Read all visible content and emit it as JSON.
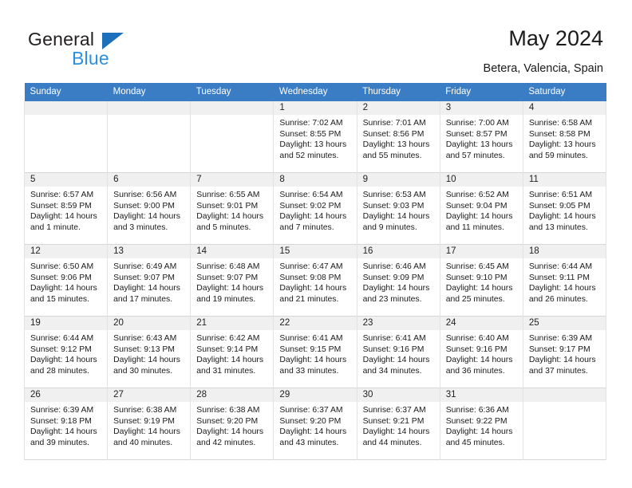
{
  "brand": {
    "name_top": "General",
    "name_bottom": "Blue",
    "triangle_color": "#1c6fba",
    "blue_color": "#2b8fe0"
  },
  "header": {
    "title": "May 2024",
    "location": "Betera, Valencia, Spain"
  },
  "theme": {
    "header_row_bg": "#3b7dc4",
    "header_row_text": "#ffffff",
    "daynum_bg": "#f0f0f0",
    "grid_line": "#e3e3e3"
  },
  "weekdays": [
    "Sunday",
    "Monday",
    "Tuesday",
    "Wednesday",
    "Thursday",
    "Friday",
    "Saturday"
  ],
  "labels": {
    "sunrise_prefix": "Sunrise: ",
    "sunset_prefix": "Sunset: ",
    "daylight_prefix": "Daylight: "
  },
  "weeks": [
    [
      {
        "empty": true
      },
      {
        "empty": true
      },
      {
        "empty": true
      },
      {
        "day": "1",
        "sunrise": "Sunrise: 7:02 AM",
        "sunset": "Sunset: 8:55 PM",
        "daylight_l1": "Daylight: 13 hours",
        "daylight_l2": "and 52 minutes."
      },
      {
        "day": "2",
        "sunrise": "Sunrise: 7:01 AM",
        "sunset": "Sunset: 8:56 PM",
        "daylight_l1": "Daylight: 13 hours",
        "daylight_l2": "and 55 minutes."
      },
      {
        "day": "3",
        "sunrise": "Sunrise: 7:00 AM",
        "sunset": "Sunset: 8:57 PM",
        "daylight_l1": "Daylight: 13 hours",
        "daylight_l2": "and 57 minutes."
      },
      {
        "day": "4",
        "sunrise": "Sunrise: 6:58 AM",
        "sunset": "Sunset: 8:58 PM",
        "daylight_l1": "Daylight: 13 hours",
        "daylight_l2": "and 59 minutes."
      }
    ],
    [
      {
        "day": "5",
        "sunrise": "Sunrise: 6:57 AM",
        "sunset": "Sunset: 8:59 PM",
        "daylight_l1": "Daylight: 14 hours",
        "daylight_l2": "and 1 minute."
      },
      {
        "day": "6",
        "sunrise": "Sunrise: 6:56 AM",
        "sunset": "Sunset: 9:00 PM",
        "daylight_l1": "Daylight: 14 hours",
        "daylight_l2": "and 3 minutes."
      },
      {
        "day": "7",
        "sunrise": "Sunrise: 6:55 AM",
        "sunset": "Sunset: 9:01 PM",
        "daylight_l1": "Daylight: 14 hours",
        "daylight_l2": "and 5 minutes."
      },
      {
        "day": "8",
        "sunrise": "Sunrise: 6:54 AM",
        "sunset": "Sunset: 9:02 PM",
        "daylight_l1": "Daylight: 14 hours",
        "daylight_l2": "and 7 minutes."
      },
      {
        "day": "9",
        "sunrise": "Sunrise: 6:53 AM",
        "sunset": "Sunset: 9:03 PM",
        "daylight_l1": "Daylight: 14 hours",
        "daylight_l2": "and 9 minutes."
      },
      {
        "day": "10",
        "sunrise": "Sunrise: 6:52 AM",
        "sunset": "Sunset: 9:04 PM",
        "daylight_l1": "Daylight: 14 hours",
        "daylight_l2": "and 11 minutes."
      },
      {
        "day": "11",
        "sunrise": "Sunrise: 6:51 AM",
        "sunset": "Sunset: 9:05 PM",
        "daylight_l1": "Daylight: 14 hours",
        "daylight_l2": "and 13 minutes."
      }
    ],
    [
      {
        "day": "12",
        "sunrise": "Sunrise: 6:50 AM",
        "sunset": "Sunset: 9:06 PM",
        "daylight_l1": "Daylight: 14 hours",
        "daylight_l2": "and 15 minutes."
      },
      {
        "day": "13",
        "sunrise": "Sunrise: 6:49 AM",
        "sunset": "Sunset: 9:07 PM",
        "daylight_l1": "Daylight: 14 hours",
        "daylight_l2": "and 17 minutes."
      },
      {
        "day": "14",
        "sunrise": "Sunrise: 6:48 AM",
        "sunset": "Sunset: 9:07 PM",
        "daylight_l1": "Daylight: 14 hours",
        "daylight_l2": "and 19 minutes."
      },
      {
        "day": "15",
        "sunrise": "Sunrise: 6:47 AM",
        "sunset": "Sunset: 9:08 PM",
        "daylight_l1": "Daylight: 14 hours",
        "daylight_l2": "and 21 minutes."
      },
      {
        "day": "16",
        "sunrise": "Sunrise: 6:46 AM",
        "sunset": "Sunset: 9:09 PM",
        "daylight_l1": "Daylight: 14 hours",
        "daylight_l2": "and 23 minutes."
      },
      {
        "day": "17",
        "sunrise": "Sunrise: 6:45 AM",
        "sunset": "Sunset: 9:10 PM",
        "daylight_l1": "Daylight: 14 hours",
        "daylight_l2": "and 25 minutes."
      },
      {
        "day": "18",
        "sunrise": "Sunrise: 6:44 AM",
        "sunset": "Sunset: 9:11 PM",
        "daylight_l1": "Daylight: 14 hours",
        "daylight_l2": "and 26 minutes."
      }
    ],
    [
      {
        "day": "19",
        "sunrise": "Sunrise: 6:44 AM",
        "sunset": "Sunset: 9:12 PM",
        "daylight_l1": "Daylight: 14 hours",
        "daylight_l2": "and 28 minutes."
      },
      {
        "day": "20",
        "sunrise": "Sunrise: 6:43 AM",
        "sunset": "Sunset: 9:13 PM",
        "daylight_l1": "Daylight: 14 hours",
        "daylight_l2": "and 30 minutes."
      },
      {
        "day": "21",
        "sunrise": "Sunrise: 6:42 AM",
        "sunset": "Sunset: 9:14 PM",
        "daylight_l1": "Daylight: 14 hours",
        "daylight_l2": "and 31 minutes."
      },
      {
        "day": "22",
        "sunrise": "Sunrise: 6:41 AM",
        "sunset": "Sunset: 9:15 PM",
        "daylight_l1": "Daylight: 14 hours",
        "daylight_l2": "and 33 minutes."
      },
      {
        "day": "23",
        "sunrise": "Sunrise: 6:41 AM",
        "sunset": "Sunset: 9:16 PM",
        "daylight_l1": "Daylight: 14 hours",
        "daylight_l2": "and 34 minutes."
      },
      {
        "day": "24",
        "sunrise": "Sunrise: 6:40 AM",
        "sunset": "Sunset: 9:16 PM",
        "daylight_l1": "Daylight: 14 hours",
        "daylight_l2": "and 36 minutes."
      },
      {
        "day": "25",
        "sunrise": "Sunrise: 6:39 AM",
        "sunset": "Sunset: 9:17 PM",
        "daylight_l1": "Daylight: 14 hours",
        "daylight_l2": "and 37 minutes."
      }
    ],
    [
      {
        "day": "26",
        "sunrise": "Sunrise: 6:39 AM",
        "sunset": "Sunset: 9:18 PM",
        "daylight_l1": "Daylight: 14 hours",
        "daylight_l2": "and 39 minutes."
      },
      {
        "day": "27",
        "sunrise": "Sunrise: 6:38 AM",
        "sunset": "Sunset: 9:19 PM",
        "daylight_l1": "Daylight: 14 hours",
        "daylight_l2": "and 40 minutes."
      },
      {
        "day": "28",
        "sunrise": "Sunrise: 6:38 AM",
        "sunset": "Sunset: 9:20 PM",
        "daylight_l1": "Daylight: 14 hours",
        "daylight_l2": "and 42 minutes."
      },
      {
        "day": "29",
        "sunrise": "Sunrise: 6:37 AM",
        "sunset": "Sunset: 9:20 PM",
        "daylight_l1": "Daylight: 14 hours",
        "daylight_l2": "and 43 minutes."
      },
      {
        "day": "30",
        "sunrise": "Sunrise: 6:37 AM",
        "sunset": "Sunset: 9:21 PM",
        "daylight_l1": "Daylight: 14 hours",
        "daylight_l2": "and 44 minutes."
      },
      {
        "day": "31",
        "sunrise": "Sunrise: 6:36 AM",
        "sunset": "Sunset: 9:22 PM",
        "daylight_l1": "Daylight: 14 hours",
        "daylight_l2": "and 45 minutes."
      },
      {
        "empty": true
      }
    ]
  ]
}
